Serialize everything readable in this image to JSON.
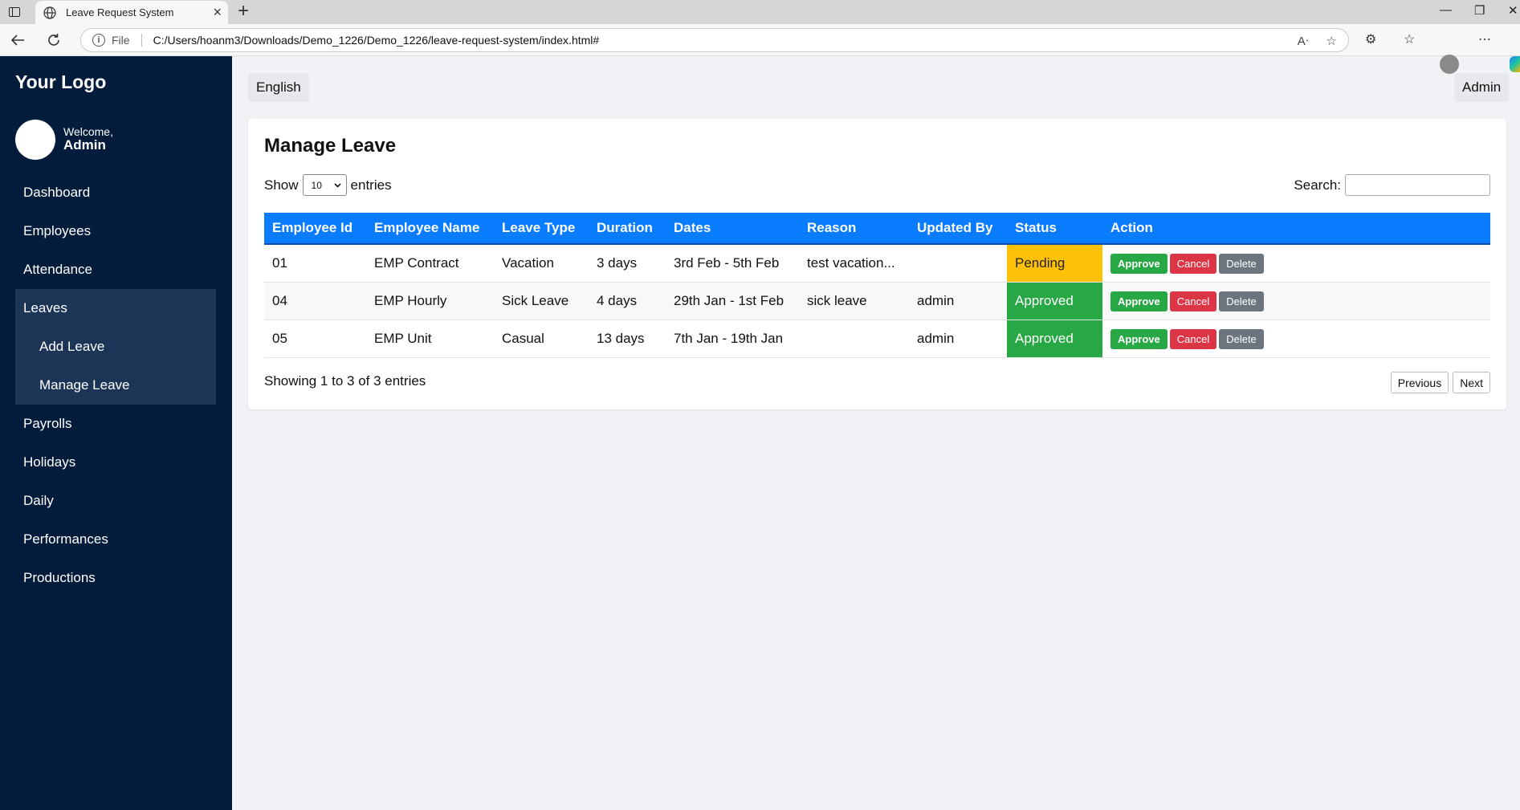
{
  "browser": {
    "tab_title": "Leave Request System",
    "address_file_label": "File",
    "url": "C:/Users/hoanm3/Downloads/Demo_1226/Demo_1226/leave-request-system/index.html#"
  },
  "sidebar": {
    "logo": "Your Logo",
    "welcome": "Welcome,",
    "user_name": "Admin",
    "items": [
      {
        "label": "Dashboard"
      },
      {
        "label": "Employees"
      },
      {
        "label": "Attendance"
      },
      {
        "label": "Leaves",
        "children": [
          {
            "label": "Add Leave"
          },
          {
            "label": "Manage Leave"
          }
        ]
      },
      {
        "label": "Payrolls"
      },
      {
        "label": "Holidays"
      },
      {
        "label": "Daily"
      },
      {
        "label": "Performances"
      },
      {
        "label": "Productions"
      }
    ]
  },
  "header": {
    "language": "English",
    "user": "Admin"
  },
  "main": {
    "title": "Manage Leave",
    "show_label": "Show",
    "page_size": "10",
    "entries_label": "entries",
    "search_label": "Search:",
    "search_value": "",
    "columns": [
      "Employee Id",
      "Employee Name",
      "Leave Type",
      "Duration",
      "Dates",
      "Reason",
      "Updated By",
      "Status",
      "Action"
    ],
    "rows": [
      {
        "id": "01",
        "name": "EMP Contract",
        "type": "Vacation",
        "duration": "3 days",
        "dates": "3rd Feb - 5th Feb",
        "reason": "test vacation...",
        "updated_by": "",
        "status": "Pending"
      },
      {
        "id": "04",
        "name": "EMP Hourly",
        "type": "Sick Leave",
        "duration": "4 days",
        "dates": "29th Jan - 1st Feb",
        "reason": "sick leave",
        "updated_by": "admin",
        "status": "Approved"
      },
      {
        "id": "05",
        "name": "EMP Unit",
        "type": "Casual",
        "duration": "13 days",
        "dates": "7th Jan - 19th Jan",
        "reason": "",
        "updated_by": "admin",
        "status": "Approved"
      }
    ],
    "actions": {
      "approve": "Approve",
      "cancel": "Cancel",
      "delete": "Delete"
    },
    "info": "Showing 1 to 3 of 3 entries",
    "pager": {
      "previous": "Previous",
      "next": "Next"
    }
  },
  "colors": {
    "sidebar_bg": "#041c3b",
    "table_header": "#0a7cff",
    "pending": "#ffc107",
    "approved": "#28a745",
    "cancel": "#dc3545",
    "delete": "#6c757d"
  }
}
